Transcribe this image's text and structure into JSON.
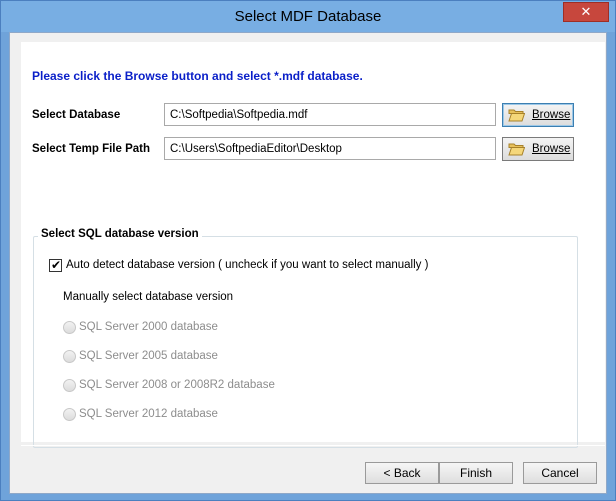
{
  "window": {
    "title": "Select MDF Database",
    "close_glyph": "✕"
  },
  "instruction": "Please click the Browse button and select *.mdf database.",
  "select_database": {
    "label": "Select Database",
    "value": "C:\\Softpedia\\Softpedia.mdf",
    "browse_label": "Browse"
  },
  "temp_path": {
    "label": "Select Temp File Path",
    "value": "C:\\Users\\SoftpediaEditor\\Desktop",
    "browse_label": "Browse"
  },
  "sql_version": {
    "group_title": "Select SQL database version",
    "auto_detect": {
      "label": "Auto detect database version ( uncheck if you want to select manually )",
      "checked": true
    },
    "manual_label": "Manually select database version",
    "options": [
      {
        "label": "SQL Server 2000 database",
        "enabled": false
      },
      {
        "label": "SQL Server 2005 database",
        "enabled": false
      },
      {
        "label": "SQL Server 2008 or 2008R2 database",
        "enabled": false
      },
      {
        "label": "SQL Server 2012 database",
        "enabled": false
      }
    ]
  },
  "buttons": {
    "back": "< Back",
    "finish": "Finish",
    "cancel": "Cancel"
  },
  "colors": {
    "instruction_text": "#0a1fc8",
    "title_bar": "#78aee3",
    "close_button": "#c7473d"
  },
  "icons": {
    "browse": "folder-open-icon",
    "checkbox": "checkmark-icon",
    "close": "close-icon"
  }
}
